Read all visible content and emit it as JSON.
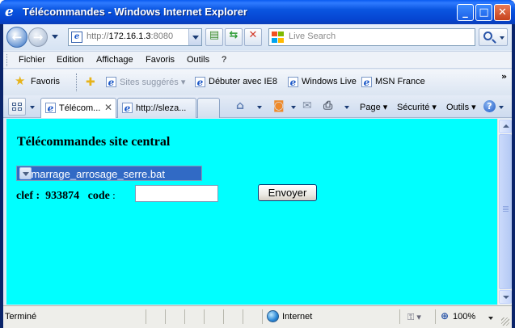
{
  "window": {
    "title": "Télécommandes - Windows Internet Explorer",
    "minimize_icon": "minimize-icon",
    "maximize_icon": "maximize-icon",
    "close_icon": "close-icon"
  },
  "address": {
    "url_prefix": "http://",
    "url_host": "172.16.1.3",
    "url_rest": ":8080",
    "search_placeholder": "Live Search"
  },
  "menu": {
    "items": [
      "Fichier",
      "Edition",
      "Affichage",
      "Favoris",
      "Outils",
      "?"
    ]
  },
  "favorites": {
    "label": "Favoris",
    "links": [
      "Sites suggérés",
      "Débuter avec IE8",
      "Windows Live",
      "MSN France"
    ]
  },
  "tabs": [
    {
      "label": "Télécom..."
    },
    {
      "label": "http://sleza..."
    }
  ],
  "command_bar": {
    "page_label": "Page",
    "security_label": "Sécurité",
    "tools_label": "Outils"
  },
  "content": {
    "heading": "Télécommandes site central",
    "select_value": "demarrage_arrosage_serre.bat",
    "key_label": "clef :",
    "key_value": "933874",
    "code_label": "code",
    "code_value": "",
    "submit_label": "Envoyer",
    "background": "#00ffff"
  },
  "status": {
    "text": "Terminé",
    "zone": "Internet",
    "zoom": "100%"
  }
}
